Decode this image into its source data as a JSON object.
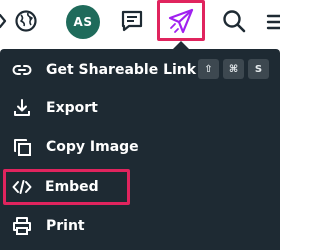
{
  "toolbar": {
    "avatar_initials": "AS",
    "icons": {
      "partial": "chevron-icon",
      "globe": "globe-icon",
      "comment": "comment-icon",
      "send": "send-icon",
      "search": "search-icon",
      "more": "more-icon"
    },
    "send_icon_color": "#a020f0",
    "highlight_color": "#e0245e",
    "avatar_color": "#1f6b5b"
  },
  "menu": {
    "background": "#1e2a33",
    "items": [
      {
        "label": "Get Shareable Link",
        "icon": "link-icon"
      },
      {
        "label": "Export",
        "icon": "download-icon"
      },
      {
        "label": "Copy Image",
        "icon": "copy-icon"
      },
      {
        "label": "Embed",
        "icon": "code-icon"
      },
      {
        "label": "Print",
        "icon": "printer-icon"
      }
    ],
    "shortcut_keys": [
      "⇧",
      "⌘",
      "S"
    ]
  }
}
